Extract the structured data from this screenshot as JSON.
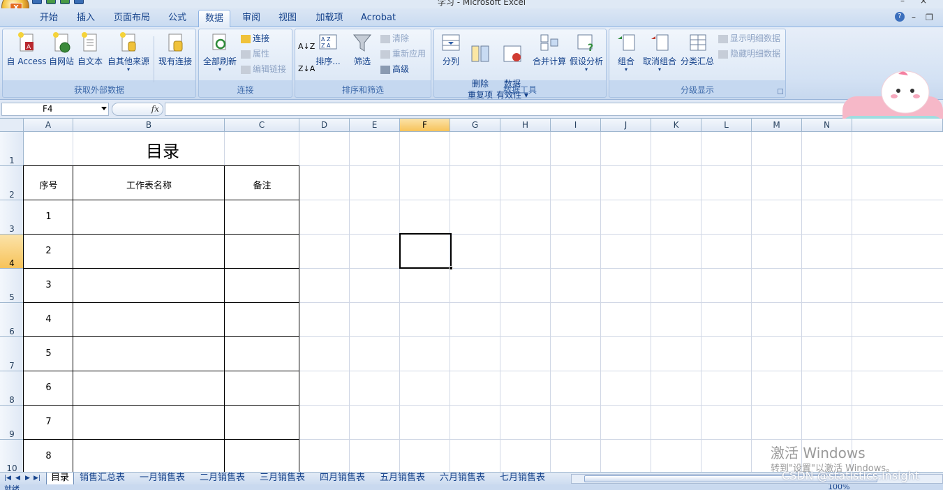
{
  "window": {
    "title": "学习 - Microsoft Excel",
    "office_logo": "X",
    "minimize": "–",
    "restore": "❐",
    "close": "×"
  },
  "tabs": [
    "开始",
    "插入",
    "页面布局",
    "公式",
    "数据",
    "审阅",
    "视图",
    "加载项",
    "Acrobat"
  ],
  "active_tab": "数据",
  "help_label": "?",
  "ribbon": {
    "groups": {
      "external": {
        "label": "获取外部数据",
        "buttons": [
          "自 Access",
          "自网站",
          "自文本",
          "自其他来源",
          "现有连接"
        ]
      },
      "connections": {
        "label": "连接",
        "refresh_all": "全部刷新",
        "small": [
          "连接",
          "属性",
          "编辑链接"
        ]
      },
      "sort_filter": {
        "label": "排序和筛选",
        "sort_az": "A↓Z",
        "sort_za": "Z↓A",
        "sort": "排序...",
        "filter": "筛选",
        "small": [
          "清除",
          "重新应用",
          "高级"
        ]
      },
      "data_tools": {
        "label": "数据工具",
        "buttons": [
          "分列",
          "删除\n重复项",
          "数据\n有效性 ▾",
          "合并计算",
          "假设分析"
        ]
      },
      "outline": {
        "label": "分级显示",
        "buttons": [
          "组合",
          "取消组合",
          "分类汇总"
        ],
        "small": [
          "显示明细数据",
          "隐藏明细数据"
        ]
      }
    }
  },
  "formula_bar": {
    "name_box": "F4",
    "fx": "fx",
    "formula": ""
  },
  "columns": [
    "A",
    "B",
    "C",
    "D",
    "E",
    "F",
    "G",
    "H",
    "I",
    "J",
    "K",
    "L",
    "M",
    "N"
  ],
  "rows": [
    "1",
    "2",
    "3",
    "4",
    "5",
    "6",
    "7",
    "8",
    "9",
    "10"
  ],
  "selected_cell": {
    "col": "F",
    "row": "4"
  },
  "sheet_content": {
    "title": "目录",
    "headers": [
      "序号",
      "工作表名称",
      "备注"
    ],
    "index_values": [
      "1",
      "2",
      "3",
      "4",
      "5",
      "6",
      "7",
      "8"
    ]
  },
  "sheet_tabs": [
    "目录",
    "销售汇总表",
    "一月销售表",
    "二月销售表",
    "三月销售表",
    "四月销售表",
    "五月销售表",
    "六月销售表",
    "七月销售表"
  ],
  "active_sheet": "目录",
  "status": {
    "ready": "就绪",
    "zoom": "100%"
  },
  "overlay": {
    "activate_windows": "激活 Windows",
    "activate_hint": "转到\"设置\"以激活 Windows。",
    "csdn": "CSDN @statistics.insight"
  },
  "colors": {
    "ribbon_bg": "#d4e2f4",
    "tab_text": "#15428b",
    "selected_header": "#f7c35a",
    "grid_line": "#d0d7e5"
  }
}
